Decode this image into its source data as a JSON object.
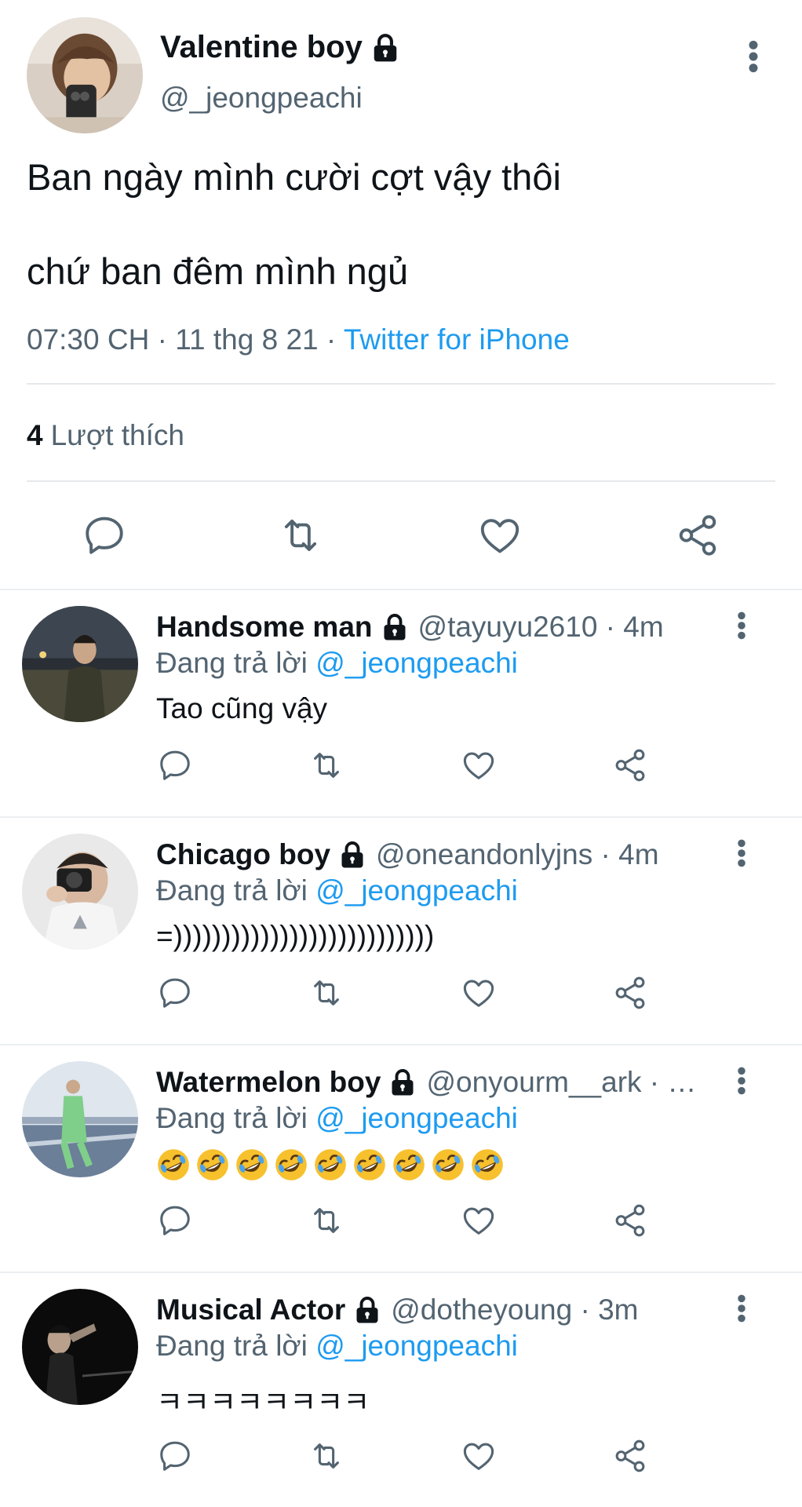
{
  "main_tweet": {
    "author_name": "Valentine boy",
    "author_handle": "@_jeongpeachi",
    "text_line1": "Ban ngày mình cười cợt vậy thôi",
    "text_line2": "chứ ban đêm mình ngủ",
    "time": "07:30 CH",
    "separator": "·",
    "date": "11 thg 8 21",
    "source": "Twitter for iPhone",
    "likes_count": "4",
    "likes_label": "Lượt thích"
  },
  "replying_label": "Đang trả lời",
  "replies": [
    {
      "name": "Handsome man",
      "handle_time": "@tayuyu2610 · 4m",
      "mention": "@_jeongpeachi",
      "text": "Tao cũng vậy"
    },
    {
      "name": "Chicago boy",
      "handle_time": "@oneandonlyjns · 4m",
      "mention": "@_jeongpeachi",
      "text": "=)))))))))))))))))))))))))))"
    },
    {
      "name": "Watermelon boy",
      "handle_time": "@onyourm__ark · …",
      "mention": "@_jeongpeachi",
      "emoji_count": 9
    },
    {
      "name": "Musical Actor",
      "handle_time": "@dotheyoung · 3m",
      "mention": "@_jeongpeachi",
      "text": "ㅋㅋㅋㅋㅋㅋㅋㅋ"
    }
  ],
  "icons": {
    "verified_lock": "lock-icon",
    "more": "more-vertical-icon",
    "reply": "comment-icon",
    "retweet": "retweet-icon",
    "like": "heart-icon",
    "share": "share-icon",
    "emoji": "rolling-laughing-emoji"
  },
  "colors": {
    "link": "#1d9bf0",
    "secondary_text": "#536471",
    "primary_text": "#0f1419",
    "divider": "#eceff1"
  }
}
